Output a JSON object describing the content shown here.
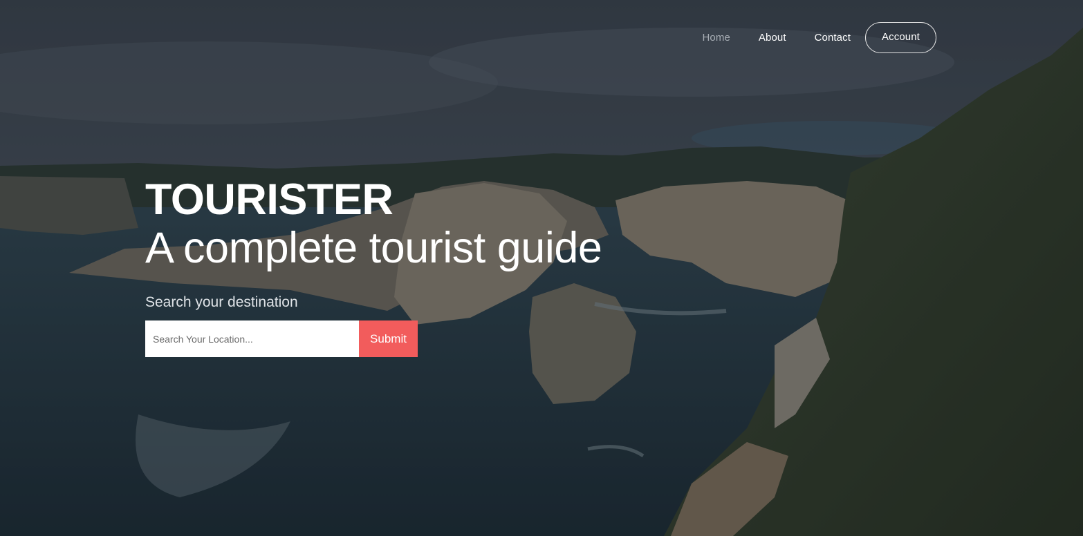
{
  "nav": {
    "items": [
      {
        "label": "Home",
        "active": true
      },
      {
        "label": "About",
        "active": false
      },
      {
        "label": "Contact",
        "active": false
      }
    ],
    "account_label": "Account"
  },
  "hero": {
    "brand": "TOURISTER",
    "tagline": "A complete tourist guide",
    "search_label": "Search your destination",
    "search_placeholder": "Search Your Location...",
    "submit_label": "Submit"
  },
  "colors": {
    "accent": "#f25c5c",
    "nav_active": "#a8aeb5",
    "text": "#ffffff"
  }
}
